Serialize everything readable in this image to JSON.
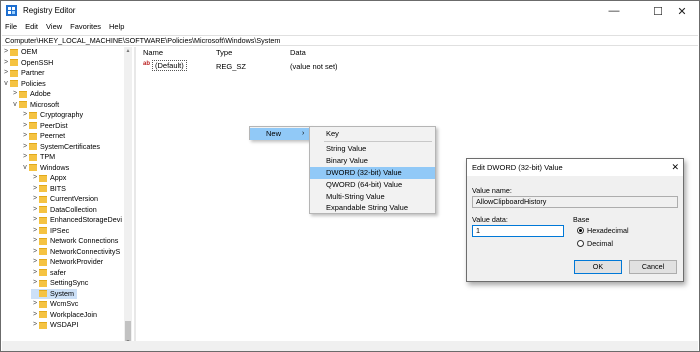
{
  "titlebar": {
    "title": "Registry Editor",
    "minimize": "—",
    "maximize": "☐",
    "close": "✕"
  },
  "menu": [
    "File",
    "Edit",
    "View",
    "Favorites",
    "Help"
  ],
  "address": "Computer\\HKEY_LOCAL_MACHINE\\SOFTWARE\\Policies\\Microsoft\\Windows\\System",
  "tree": [
    {
      "label": "OEM",
      "chev": ">"
    },
    {
      "label": "OpenSSH",
      "chev": ">"
    },
    {
      "label": "Partner",
      "chev": ">"
    },
    {
      "label": "Policies",
      "chev": "v"
    },
    {
      "label": "Adobe",
      "chev": ">"
    },
    {
      "label": "Microsoft",
      "chev": "v"
    },
    {
      "label": "Cryptography",
      "chev": ">"
    },
    {
      "label": "PeerDist",
      "chev": ">"
    },
    {
      "label": "Peernet",
      "chev": ">"
    },
    {
      "label": "SystemCertificates",
      "chev": ">"
    },
    {
      "label": "TPM",
      "chev": ">"
    },
    {
      "label": "Windows",
      "chev": "v"
    },
    {
      "label": "Appx",
      "chev": ">"
    },
    {
      "label": "BITS",
      "chev": ">"
    },
    {
      "label": "CurrentVersion",
      "chev": ">"
    },
    {
      "label": "DataCollection",
      "chev": ">"
    },
    {
      "label": "EnhancedStorageDevi",
      "chev": ">"
    },
    {
      "label": "IPSec",
      "chev": ">"
    },
    {
      "label": "Network Connections",
      "chev": ">"
    },
    {
      "label": "NetworkConnectivityS",
      "chev": ">"
    },
    {
      "label": "NetworkProvider",
      "chev": ">"
    },
    {
      "label": "safer",
      "chev": ">"
    },
    {
      "label": "SettingSync",
      "chev": ">"
    },
    {
      "label": "System",
      "chev": ""
    },
    {
      "label": "WcmSvc",
      "chev": ">"
    },
    {
      "label": "WorkplaceJoin",
      "chev": ">"
    },
    {
      "label": "WSDAPI",
      "chev": ">"
    }
  ],
  "list": {
    "headers": {
      "name": "Name",
      "type": "Type",
      "data": "Data"
    },
    "rows": [
      {
        "icon": "ab",
        "name": "(Default)",
        "type": "REG_SZ",
        "data": "(value not set)"
      }
    ]
  },
  "context_menu": {
    "new_label": "New",
    "submenu": [
      "Key",
      "String Value",
      "Binary Value",
      "DWORD (32-bit) Value",
      "QWORD (64-bit) Value",
      "Multi-String Value",
      "Expandable String Value"
    ]
  },
  "dialog": {
    "title": "Edit DWORD (32-bit) Value",
    "close": "✕",
    "value_name_label": "Value name:",
    "value_name": "AllowClipboardHistory",
    "value_data_label": "Value data:",
    "value_data": "1",
    "base_label": "Base",
    "hex_label": "Hexadecimal",
    "dec_label": "Decimal",
    "ok": "OK",
    "cancel": "Cancel"
  },
  "colors": {
    "highlight": "#91c9f7",
    "tree_selection": "#cce0f7",
    "folder": "#f5c342",
    "accent": "#0078d7"
  }
}
